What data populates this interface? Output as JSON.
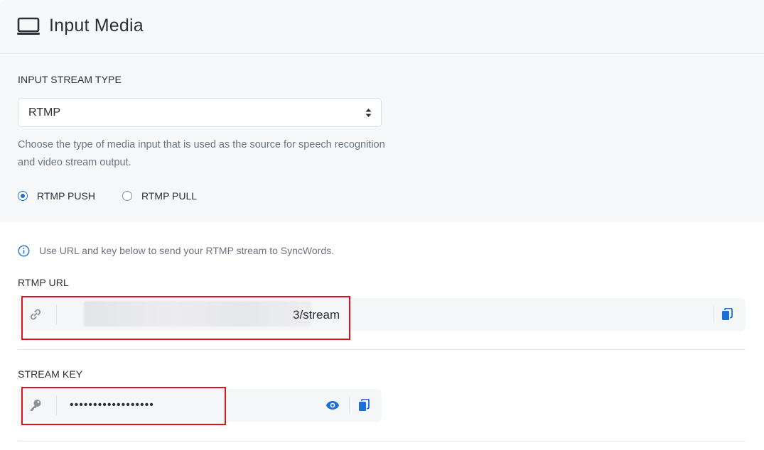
{
  "header": {
    "title": "Input Media",
    "icon": "monitor-icon"
  },
  "stream_type": {
    "label": "INPUT STREAM TYPE",
    "selected": "RTMP",
    "help": "Choose the type of media input that is used as the source for speech recognition and video stream output."
  },
  "mode": {
    "options": [
      {
        "label": "RTMP PUSH",
        "checked": true
      },
      {
        "label": "RTMP PULL",
        "checked": false
      }
    ]
  },
  "info": {
    "text": "Use URL and key below to send your RTMP stream to SyncWords."
  },
  "rtmp_url": {
    "label": "RTMP URL",
    "value_suffix": "3/stream"
  },
  "stream_key": {
    "label": "STREAM KEY",
    "value": "••••••••••••••••••"
  },
  "colors": {
    "accent": "#1b6fd6",
    "highlight": "#e0121b",
    "panel": "#f7f8fa"
  }
}
